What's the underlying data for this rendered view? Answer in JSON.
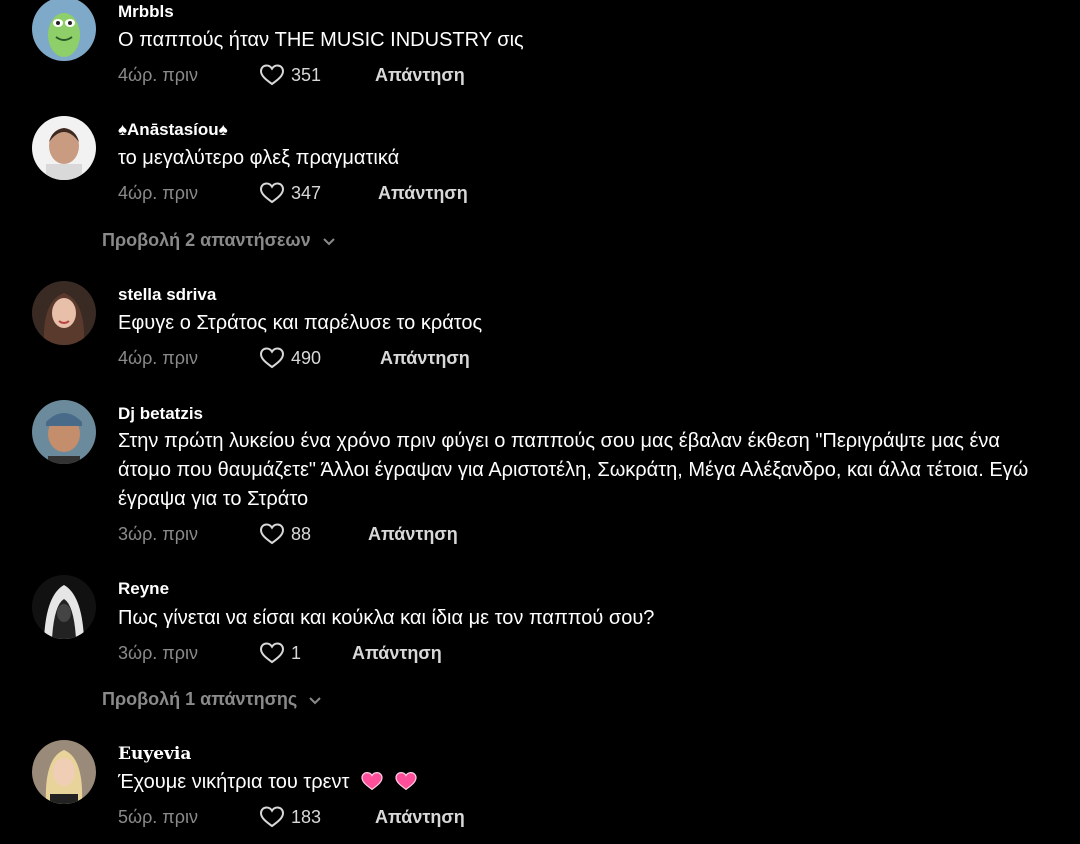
{
  "comments": [
    {
      "username": "Mrbbls",
      "text": "Ο παππούς ήταν THE MUSIC INDUSTRY σις",
      "time": "4ώρ. πριν",
      "likes": "351",
      "reply": "Απάντηση"
    },
    {
      "username": "♠Anāstasíou♠",
      "text": "το μεγαλύτερο φλεξ πραγματικά",
      "time": "4ώρ. πριν",
      "likes": "347",
      "reply": "Απάντηση"
    },
    {
      "username": "stella sdriva",
      "text": "Εφυγε ο Στράτος και παρέλυσε το κράτος",
      "time": "4ώρ. πριν",
      "likes": "490",
      "reply": "Απάντηση"
    },
    {
      "username": "Dj betatzis",
      "text": "Στην πρώτη λυκείου ένα χρόνο πριν φύγει ο παππούς σου μας έβαλαν έκθεση \"Περιγράψτε μας ένα άτομο που θαυμάζετε\" Άλλοι έγραψαν για Αριστοτέλη, Σωκράτη, Μέγα Αλέξανδρο, και άλλα τέτοια. Εγώ έγραψα για το Στράτο",
      "time": "3ώρ. πριν",
      "likes": "88",
      "reply": "Απάντηση"
    },
    {
      "username": "Reyne",
      "text": "Πως γίνεται να είσαι και κούκλα και ίδια με τον παππού σου?",
      "time": "3ώρ. πριν",
      "likes": "1",
      "reply": "Απάντηση"
    },
    {
      "username": "𝐄𝐮𝐲𝐞𝐯𝐢𝐚",
      "text": "Έχουμε νικήτρια του τρεντ",
      "time": "5ώρ. πριν",
      "likes": "183",
      "reply": "Απάντηση"
    }
  ],
  "view_replies": [
    {
      "label": "Προβολή 2 απαντήσεων"
    },
    {
      "label": "Προβολή 1 απάντησης"
    }
  ],
  "icons": {
    "like": "heart-outline-icon",
    "expand": "chevron-down-icon",
    "emoji": "pink-heart-emoji"
  },
  "colors": {
    "background": "#000000",
    "muted": "#8a8a8a",
    "emoji_heart": "#ff4f9a"
  }
}
